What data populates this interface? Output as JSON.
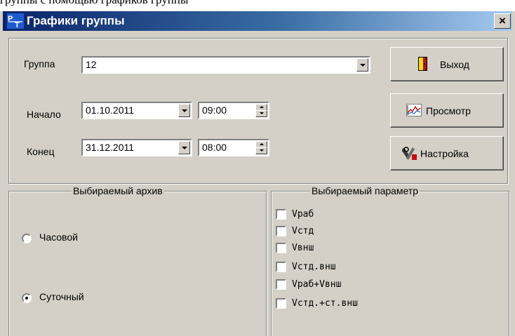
{
  "top_strip": {
    "cut_text": "группы с помощью графиков группы"
  },
  "window": {
    "title": "Графики группы",
    "close_symbol": "×"
  },
  "form": {
    "group_label": "Группа",
    "group_value": "12",
    "start_label": "Начало",
    "start_date": "01.10.2011",
    "start_time": "09:00",
    "end_label": "Конец",
    "end_date": "31.12.2011",
    "end_time": "08:00"
  },
  "buttons": {
    "exit_label": "Выход",
    "view_label": "Просмотр",
    "settings_label": "Настройка"
  },
  "archive_group": {
    "title": "Выбираемый архив",
    "options": [
      {
        "label": "Часовой",
        "checked": false
      },
      {
        "label": "Суточный",
        "checked": true
      }
    ]
  },
  "param_group": {
    "title": "Выбираемый параметр",
    "items": [
      "Vраб",
      "Vстд",
      "Vвнш",
      "Vстд.внш",
      "Vраб+Vвнш",
      "Vстд.+ст.внш"
    ]
  }
}
